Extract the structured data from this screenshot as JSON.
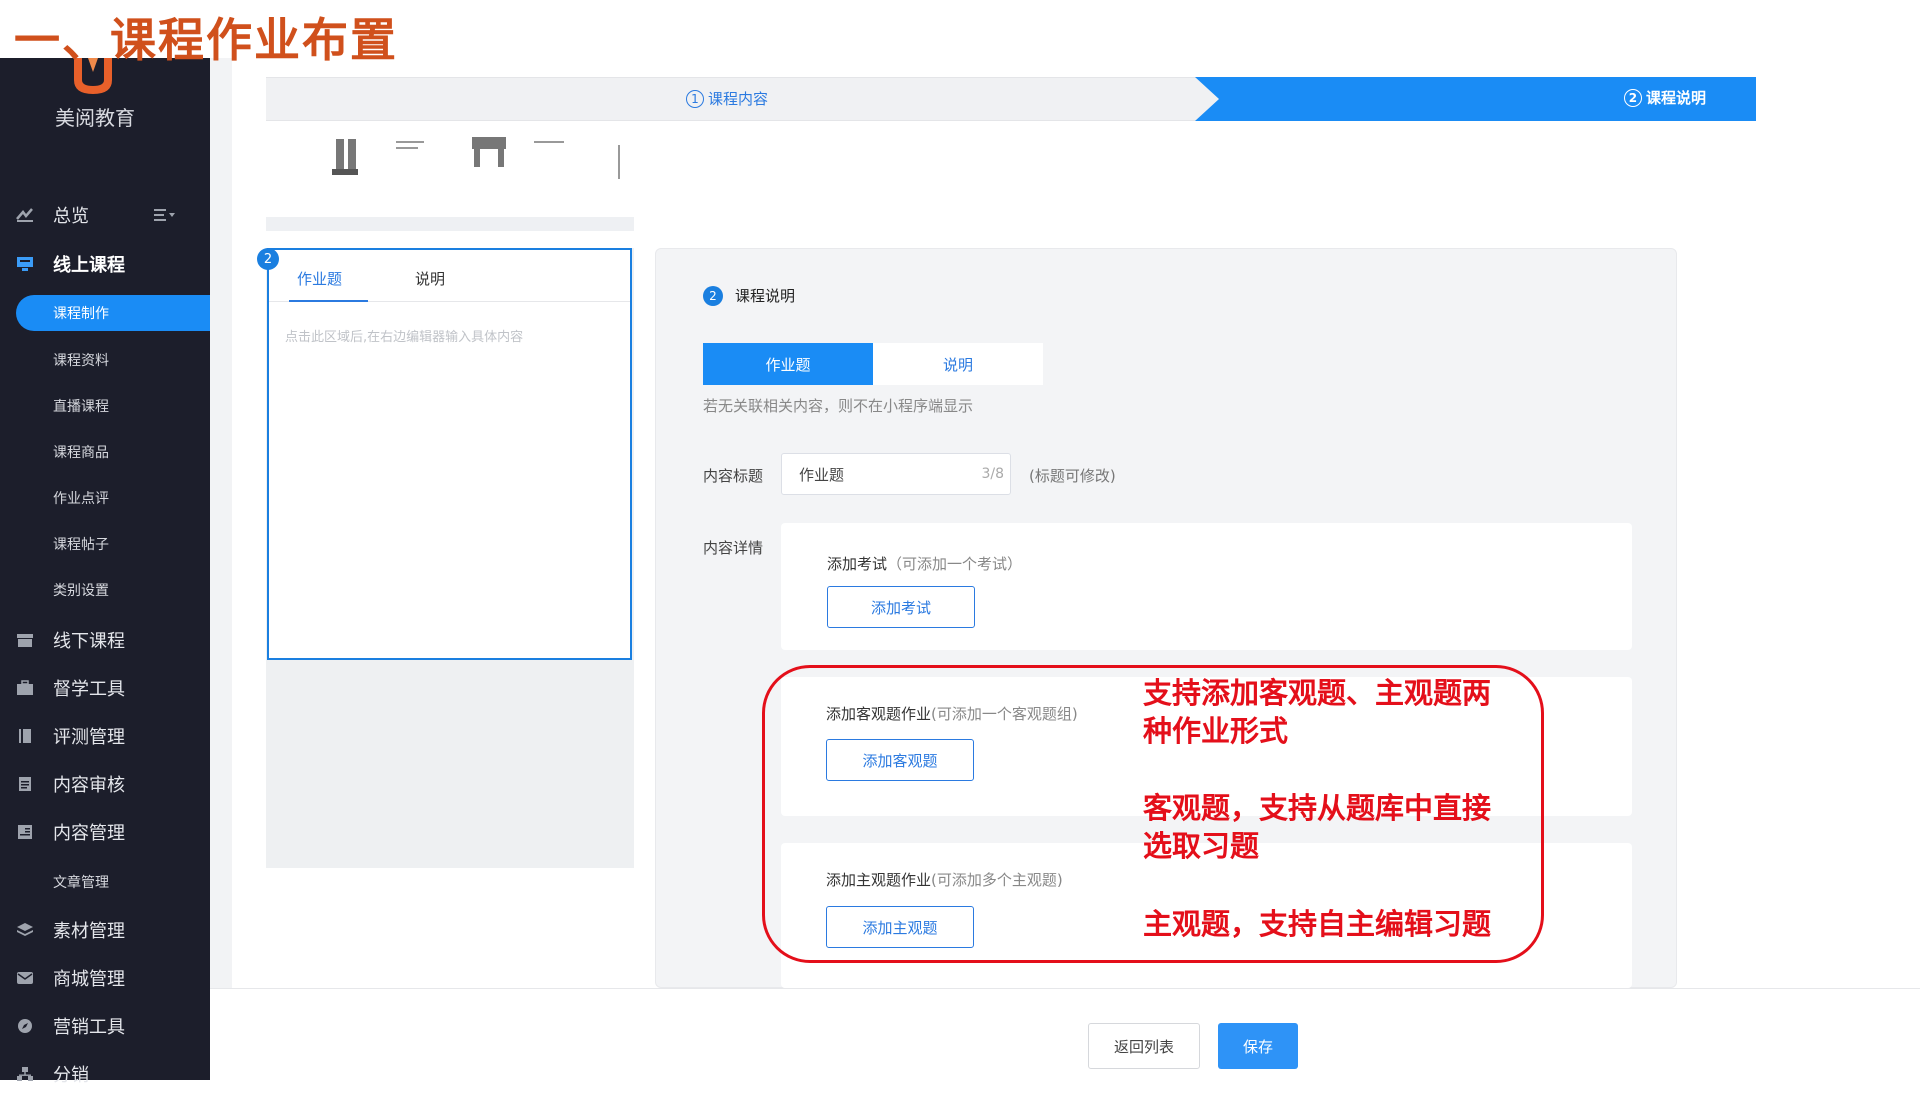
{
  "slide_title": "一、课程作业布置",
  "brand": "美阅教育",
  "sidebar": {
    "items": [
      {
        "label": "总览"
      },
      {
        "label": "线上课程"
      },
      {
        "label": "线下课程"
      },
      {
        "label": "督学工具"
      },
      {
        "label": "评测管理"
      },
      {
        "label": "内容审核"
      },
      {
        "label": "内容管理"
      },
      {
        "label": "素材管理"
      },
      {
        "label": "商城管理"
      },
      {
        "label": "营销工具"
      },
      {
        "label": "分销"
      }
    ],
    "online_sub": [
      {
        "label": "课程制作"
      },
      {
        "label": "课程资料"
      },
      {
        "label": "直播课程"
      },
      {
        "label": "课程商品"
      },
      {
        "label": "作业点评"
      },
      {
        "label": "课程帖子"
      },
      {
        "label": "类别设置"
      }
    ],
    "content_sub": [
      {
        "label": "文章管理"
      }
    ]
  },
  "steps": {
    "step1": {
      "num": "1",
      "label": "课程内容"
    },
    "step2": {
      "num": "2",
      "label": "课程说明"
    }
  },
  "preview": {
    "badge": "2",
    "tab_active": "作业题",
    "tab_other": "说明",
    "hint": "点击此区域后,在右边编辑器输入具体内容"
  },
  "panel": {
    "num": "2",
    "title": "课程说明",
    "seg_on": "作业题",
    "seg_off": "说明",
    "seg_note": "若无关联相关内容，则不在小程序端显示",
    "title_label": "内容标题",
    "title_value": "作业题",
    "title_count": "3/8",
    "title_hint": "(标题可修改)",
    "detail_label": "内容详情",
    "exam": {
      "head": "添加考试",
      "sub": "（可添加一个考试）",
      "button": "添加考试"
    },
    "objective": {
      "head": "添加客观题作业",
      "sub": "(可添加一个客观题组)",
      "button": "添加客观题"
    },
    "subjective": {
      "head": "添加主观题作业",
      "sub": "(可添加多个主观题)",
      "button": "添加主观题"
    }
  },
  "callout": {
    "line1": "支持添加客观题、主观题两",
    "line2": "种作业形式",
    "line3": "客观题，支持从题库中直接",
    "line4": "选取习题",
    "line5": "主观题，支持自主编辑习题"
  },
  "footer": {
    "back": "返回列表",
    "save": "保存"
  },
  "colors": {
    "accent": "#1a8cf5",
    "sidebar_bg": "#1c1e2b",
    "title_orange": "#d0501c",
    "callout_red": "#e40f1a"
  }
}
